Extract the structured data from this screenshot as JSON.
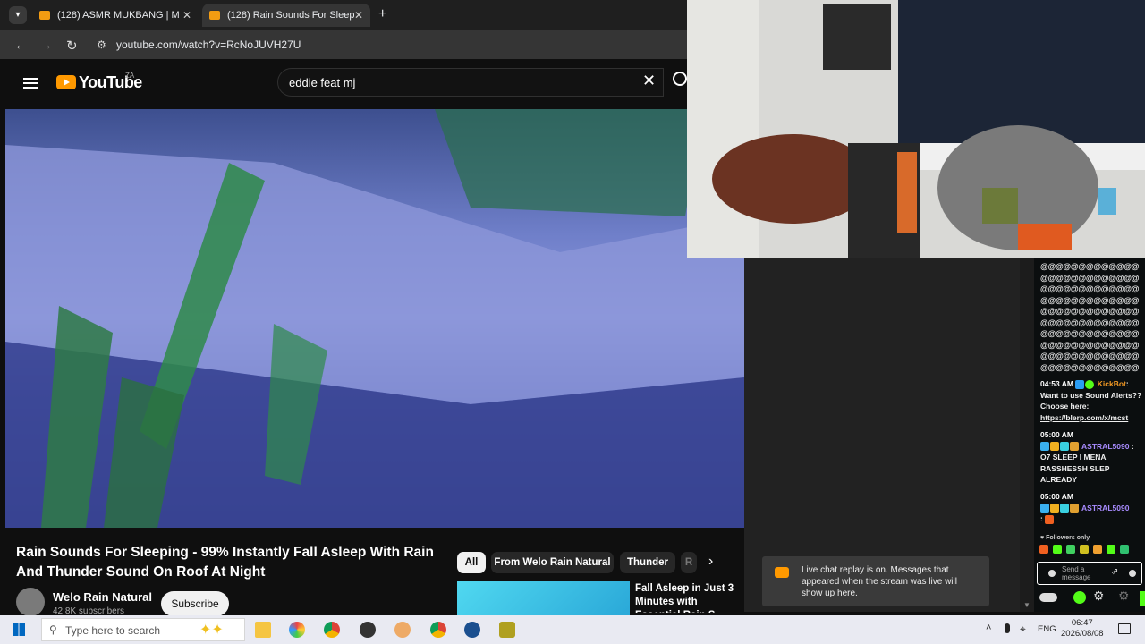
{
  "browser": {
    "tabs": [
      {
        "title": "(128) ASMR MUKBANG | M",
        "active": false
      },
      {
        "title": "(128) Rain Sounds For Sleep",
        "active": true
      }
    ],
    "new_tab_label": "+",
    "url": "youtube.com/watch?v=RcNoJUVH27U"
  },
  "youtube": {
    "logo_text": "YouTube",
    "logo_sup": "ZA",
    "search_value": "eddie feat mj",
    "video_title": "Rain Sounds For Sleeping - 99% Instantly Fall Asleep With Rain And Thunder Sound On Roof At Night",
    "channel_name": "Welo Rain Natural",
    "subscribers": "42.8K subscribers",
    "subscribe_label": "Subscribe",
    "chips": [
      "All",
      "From Welo Rain Natural",
      "Thunder",
      "R"
    ],
    "recommendation_title": "Fall Asleep in Just 3 Minutes with Essential Rain S",
    "replay_notice": "Live chat replay is on. Messages that appeared when the stream was live will show up here."
  },
  "kick_chat": {
    "spam_block": "@@@@@@@@@@@@@@@@@@@@@@@@@@@@@@@@@@@@@@@@@@@@@@@@@@@@@@@@@@@@@@@@@@@@@@@@@@@@@@@@@@@@@@@@@@@@@@@@@@@@@@@@@@@@@@@@@@@@@@@@@@@@@@@@@@",
    "messages": [
      {
        "time": "04:53 AM",
        "user": "KickBot",
        "text": "Want to use Sound Alerts?? Choose here:",
        "link": "https://blerp.com/x/mcst"
      },
      {
        "time": "05:00 AM",
        "user": "ASTRAL5090",
        "text": ": O7 SLEEP I MENA RASSHESSH SLEP ALREADY"
      },
      {
        "time": "05:00 AM",
        "user": "ASTRAL5090",
        "text": ":"
      }
    ],
    "followers_only": "Followers only",
    "input_placeholder": "Send a message"
  },
  "taskbar": {
    "search_placeholder": "Type here to search",
    "language": "ENG",
    "time": "06:47",
    "date": "2026/08/08"
  },
  "colors": {
    "yt_logo": "#ff9900",
    "kick_green": "#53fc18",
    "astral_name": "#a88bff",
    "kickbot_name": "#f59a23"
  }
}
